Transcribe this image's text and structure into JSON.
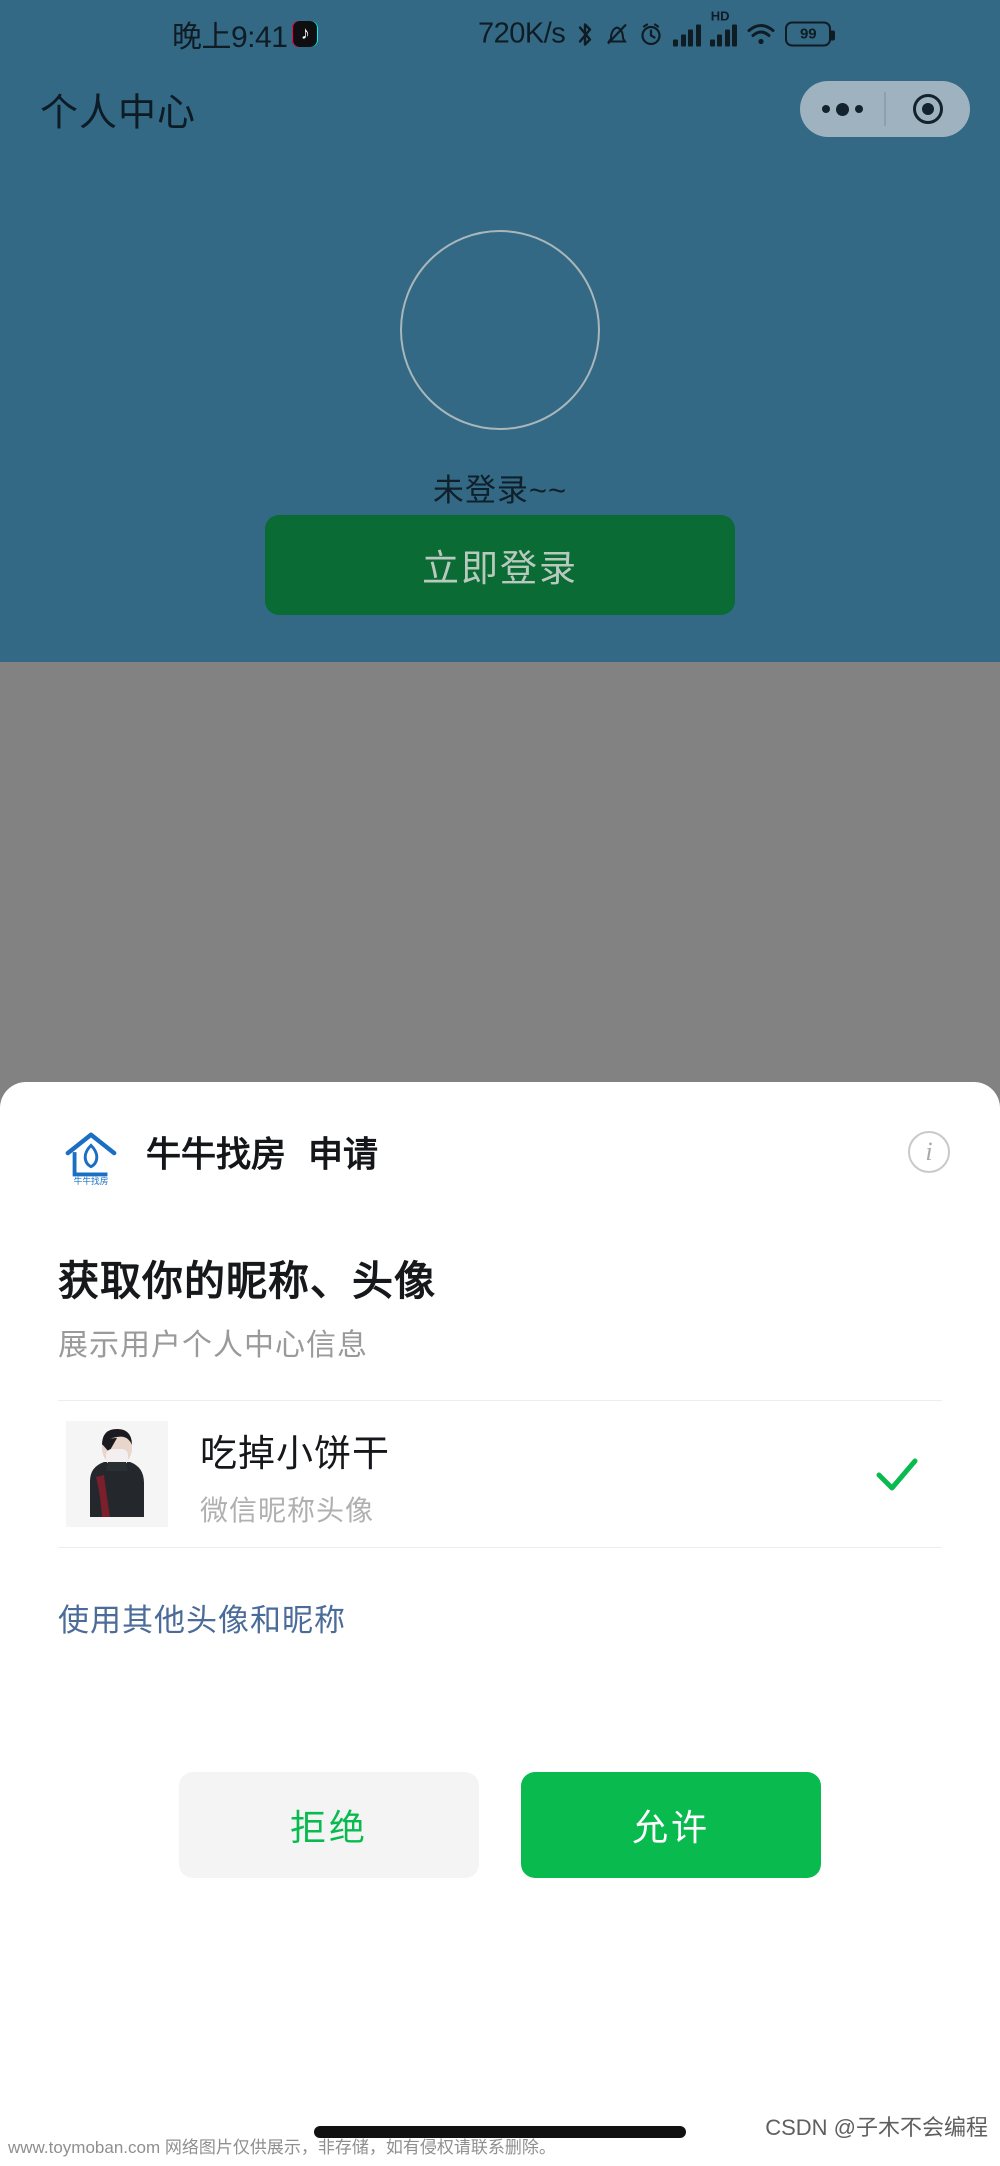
{
  "status_bar": {
    "time": "晚上9:41",
    "app_badge_icon": "tiktok-icon",
    "network_speed": "720K/s",
    "icons": [
      "bluetooth-icon",
      "mute-icon",
      "alarm-icon",
      "signal-icon",
      "hd-signal-icon",
      "wifi-icon"
    ],
    "hd_label": "HD",
    "battery_level": "99"
  },
  "nav_bar": {
    "title": "个人中心",
    "capsule": {
      "more_icon": "more-dots-icon",
      "close_icon": "target-close-icon"
    }
  },
  "profile": {
    "avatar_icon": "empty-avatar-circle",
    "login_status": "未登录~~",
    "login_button": "立即登录",
    "header_bg": "#336985",
    "login_button_bg": "#0a6b34"
  },
  "auth_sheet": {
    "app_logo_icon": "house-logo-icon",
    "app_name": "牛牛找房",
    "action_label": "申请",
    "info_icon": "info-icon",
    "scope_title": "获取你的昵称、头像",
    "scope_desc": "展示用户个人中心信息",
    "identity": {
      "avatar_icon": "user-photo-avatar",
      "name": "吃掉小饼干",
      "source": "微信昵称头像",
      "selected_icon": "check-icon",
      "selected": true
    },
    "other_identity_link": "使用其他头像和昵称",
    "reject_button": "拒绝",
    "allow_button": "允许",
    "accent_green": "#09bb4f",
    "link_color": "#4b6b99"
  },
  "footer": {
    "home_indicator_icon": "home-indicator",
    "watermark_left": "www.toymoban.com 网络图片仅供展示，非存储，如有侵权请联系删除。",
    "watermark_right": "CSDN @子木不会编程"
  }
}
